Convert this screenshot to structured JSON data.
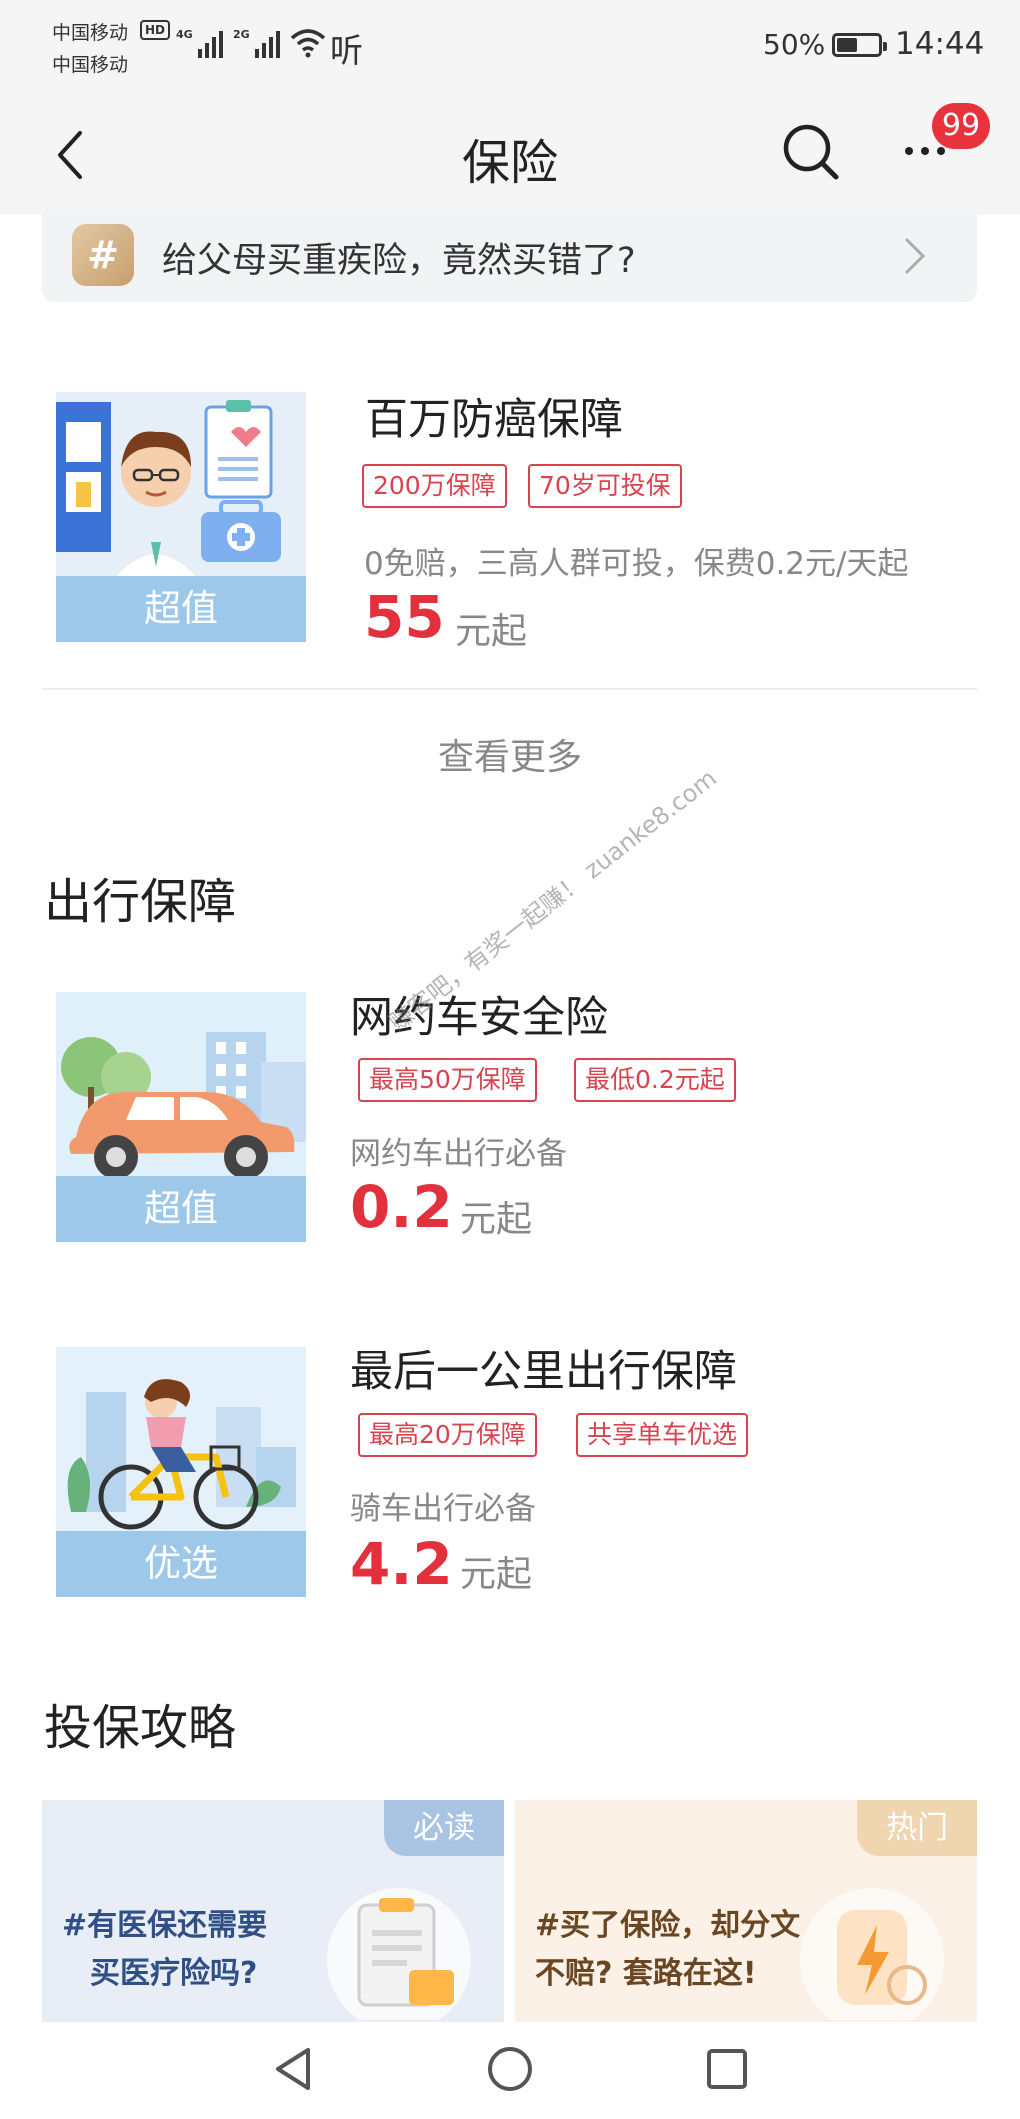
{
  "status_bar": {
    "carrier_1": "中国移动",
    "hd": "HD",
    "carrier_2": "中国移动",
    "net_1": "4G",
    "net_2": "2G",
    "listen": "听",
    "battery_percent": "50%",
    "battery_level": 0.5,
    "time": "14:44"
  },
  "nav": {
    "title": "保险",
    "badge_count": "99"
  },
  "topic": {
    "icon": "#",
    "text": "给父母买重疾险，竟然买错了?"
  },
  "featured": {
    "title": "百万防癌保障",
    "tags": [
      "200万保障",
      "70岁可投保"
    ],
    "desc": "0免赔，三高人群可投，保费0.2元/天起",
    "price": "55",
    "unit": "元起",
    "thumb_label": "超值"
  },
  "see_more": "查看更多",
  "travel": {
    "section_title": "出行保障",
    "items": [
      {
        "title": "网约车安全险",
        "tags": [
          "最高50万保障",
          "最低0.2元起"
        ],
        "desc": "网约车出行必备",
        "price": "0.2",
        "unit": "元起",
        "thumb_label": "超值"
      },
      {
        "title": "最后一公里出行保障",
        "tags": [
          "最高20万保障",
          "共享单车优选"
        ],
        "desc": "骑车出行必备",
        "price": "4.2",
        "unit": "元起",
        "thumb_label": "优选"
      }
    ]
  },
  "watermark": "赚客吧，有奖一起赚！ zuanke8.com",
  "guide": {
    "section_title": "投保攻略",
    "cards": [
      {
        "tag": "必读",
        "line1": "#有医保还需要",
        "line2": "买医疗险吗?"
      },
      {
        "tag": "热门",
        "line1": "#买了保险，却分文",
        "line2": "不赔? 套路在这!"
      }
    ]
  },
  "colors": {
    "accent_red": "#e2313d",
    "tag_red": "#d9434f",
    "badge_red": "#e8323c",
    "thumb_label_blue": "#9dc8ea"
  },
  "icons": [
    "back-icon",
    "search-icon",
    "more-icon",
    "hash-icon",
    "chevron-right-icon",
    "back-triangle-icon",
    "home-circle-icon",
    "recents-square-icon"
  ]
}
